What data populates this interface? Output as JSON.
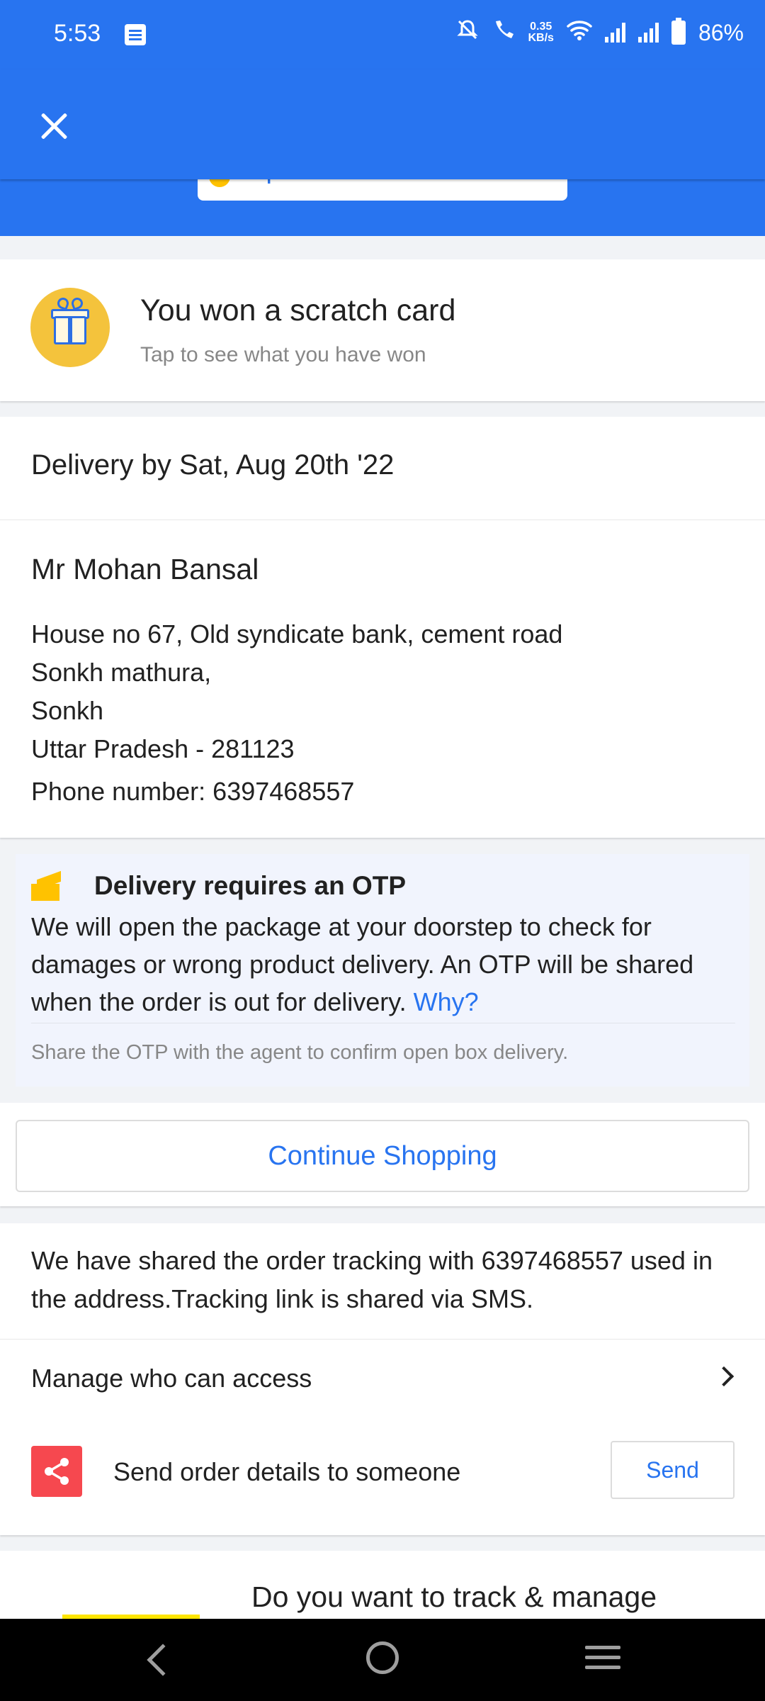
{
  "status_bar": {
    "time": "5:53",
    "speed_value": "0.35",
    "speed_unit": "KB/s",
    "battery": "86%"
  },
  "header": {
    "close_icon": "close-icon",
    "peek_text": "Supercoins Gained"
  },
  "scratch_card": {
    "title": "You won a scratch card",
    "subtitle": "Tap to see what you have won"
  },
  "delivery": {
    "date_text": "Delivery by Sat, Aug 20th '22",
    "name": "Mr Mohan Bansal",
    "address_lines": [
      "House no 67, Old syndicate bank, cement road",
      "Sonkh mathura,",
      "Sonkh",
      "Uttar Pradesh - 281123"
    ],
    "phone": "Phone number: 6397468557"
  },
  "otp": {
    "title": "Delivery requires an OTP",
    "body": "We will open the package at your doorstep to check for damages or wrong product delivery. An OTP will be shared when the order is out for delivery.",
    "why_link": "Why?",
    "note": "Share the OTP with the agent to confirm open box delivery."
  },
  "actions": {
    "continue_shopping": "Continue Shopping"
  },
  "tracking": {
    "text": "We have shared the order tracking with 6397468557 used in the address.Tracking link is shared via SMS.",
    "manage_label": "Manage who can access",
    "share_label": "Send order details to someone",
    "send_button": "Send"
  },
  "promo": {
    "text": "Do you want to track & manage"
  },
  "colors": {
    "brand_blue": "#2874f0",
    "share_red": "#f6484f",
    "gift_yellow": "#f4c33c"
  }
}
